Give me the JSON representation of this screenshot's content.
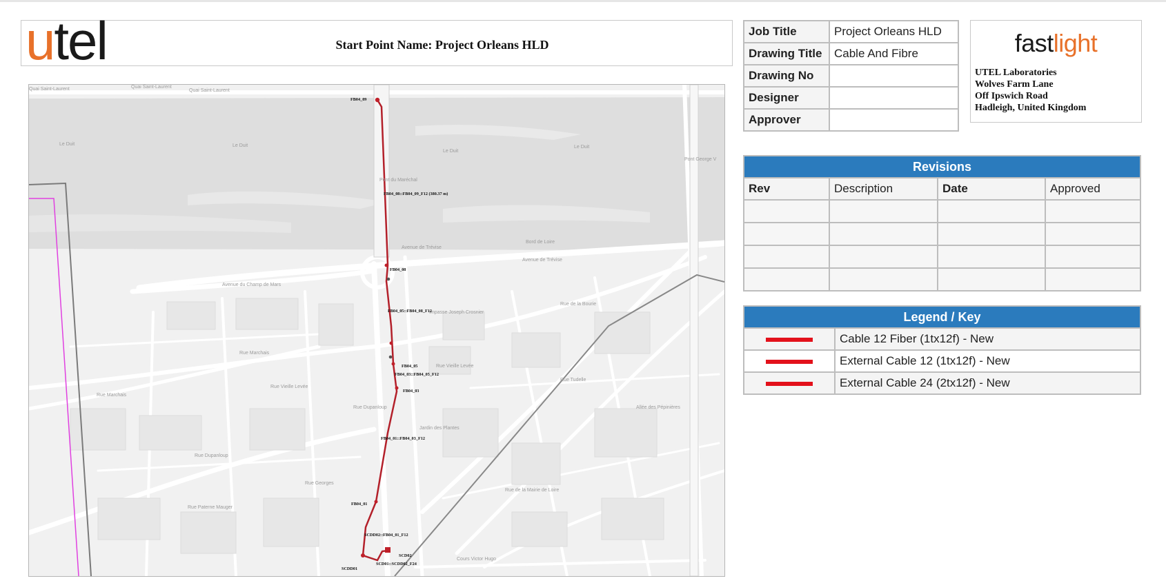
{
  "header": {
    "logo_u": "u",
    "logo_rest": "tel",
    "start_point": "Start Point Name: Project Orleans HLD"
  },
  "info_table": [
    {
      "label": "Job Title",
      "value": "Project Orleans HLD"
    },
    {
      "label": "Drawing Title",
      "value": "Cable And Fibre"
    },
    {
      "label": "Drawing No",
      "value": ""
    },
    {
      "label": "Designer",
      "value": ""
    },
    {
      "label": "Approver",
      "value": ""
    }
  ],
  "brand": {
    "fast": "fast",
    "light": "light",
    "address_lines": [
      "UTEL Laboratories",
      "Wolves Farm Lane",
      "Off Ipswich Road",
      "Hadleigh, United Kingdom"
    ],
    "accent_color": "#e8712a"
  },
  "revisions": {
    "title": "Revisions",
    "columns": [
      "Rev",
      "Description",
      "Date",
      "Approved"
    ],
    "rows": [
      [
        "",
        "",
        "",
        ""
      ],
      [
        "",
        "",
        "",
        ""
      ],
      [
        "",
        "",
        "",
        ""
      ],
      [
        "",
        "",
        "",
        ""
      ]
    ],
    "header_color": "#2b7bbd"
  },
  "legend": {
    "title": "Legend / Key",
    "items": [
      {
        "label": "Cable 12 Fiber (1tx12f) - New",
        "color": "#e3111b"
      },
      {
        "label": "External Cable 12 (1tx12f) - New",
        "color": "#e3111b"
      },
      {
        "label": "External Cable 24 (2tx12f) - New",
        "color": "#e3111b"
      }
    ]
  },
  "map": {
    "street_labels": [
      "Quai Saint-Laurent",
      "Quai Saint-Laurent",
      "Quai Saint-Laurent",
      "Le Duit",
      "Le Duit",
      "Le Duit",
      "Le Duit",
      "Pont du Maréchal",
      "Bord de Loire",
      "Avenue de Trévise",
      "Avenue de Trévise",
      "Avenue du Champ de Mars",
      "Rue Marchais",
      "Rue Marchais",
      "Rue Vieille Levée",
      "Rue Vieille Levée",
      "Rue Dupanloup",
      "Rue Dupanloup",
      "Jardin des Plantes",
      "Pont George V",
      "Rue Tudelle",
      "Rue de la Mairie de Loire",
      "Cours Victor Hugo",
      "Impasse Joseph Crosnier",
      "Rue Georges",
      "Rue Paterne Mauger",
      "Rue de la Bourie",
      "Allée des Pépinières"
    ],
    "node_labels": [
      "FB04_09",
      "FB04_08::FB04_09_F12 (380.37 m)",
      "FB04_08",
      "FB04_05::FB04_08_F12",
      "FB04_05",
      "FB04_03::FB04_05_F12",
      "FB04_03",
      "FB04_01::FB04_03_F12",
      "FB04_01",
      "SCDD02::FB04_01_F12",
      "SCD02",
      "SCD01::SCDD02_F24",
      "SCDD01"
    ],
    "route_color": "#b3202a"
  }
}
